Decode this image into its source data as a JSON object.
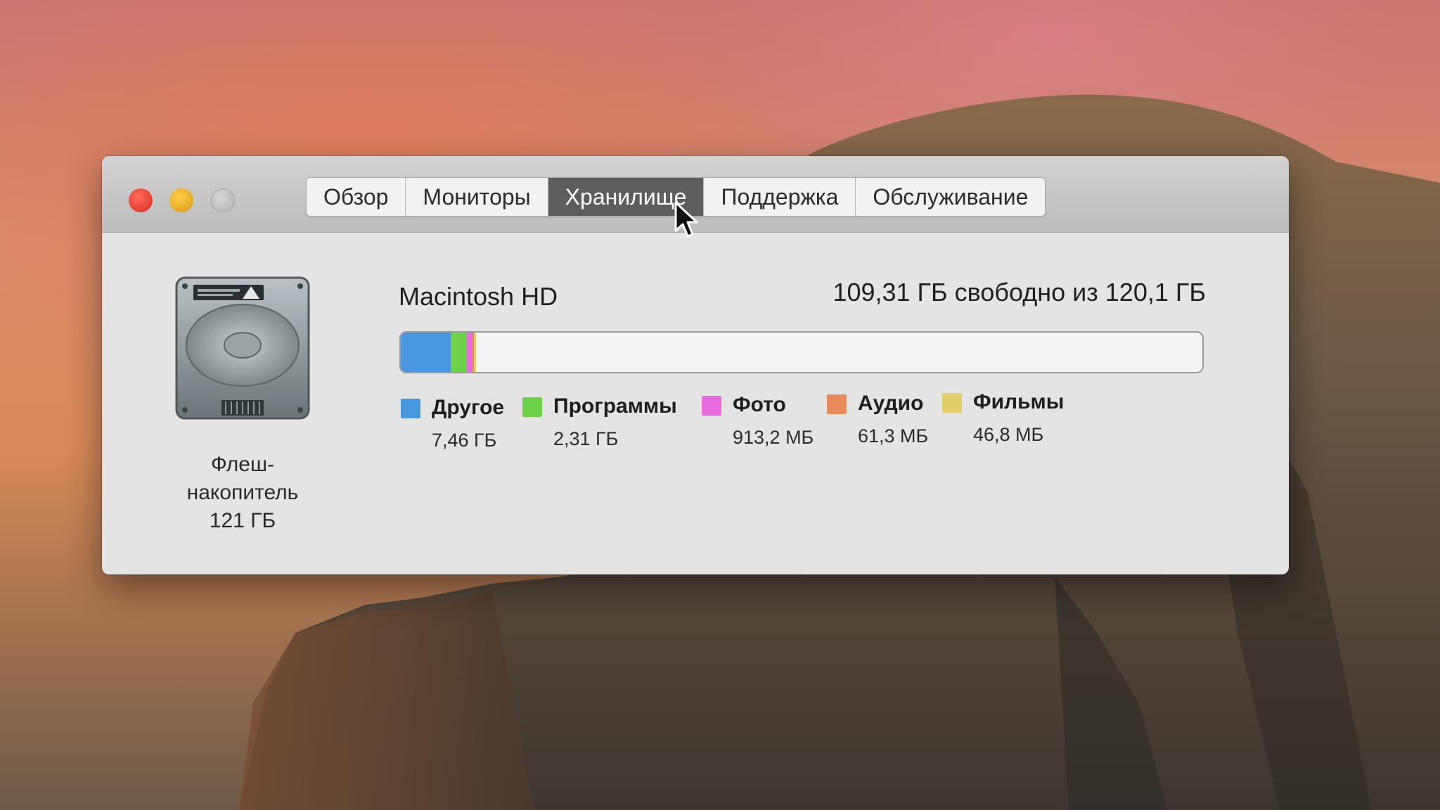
{
  "window": {
    "tabs": [
      {
        "label": "Обзор",
        "active": false
      },
      {
        "label": "Мониторы",
        "active": false
      },
      {
        "label": "Хранилище",
        "active": true
      },
      {
        "label": "Поддержка",
        "active": false
      },
      {
        "label": "Обслуживание",
        "active": false
      }
    ]
  },
  "disk": {
    "icon": "hard-drive-icon",
    "label_lines": [
      "Флеш-",
      "накопитель",
      "121 ГБ"
    ]
  },
  "volume": {
    "name": "Macintosh HD",
    "free_text": "109,31 ГБ свободно из 120,1 ГБ",
    "total_gb": 120.1,
    "free_gb": 109.31
  },
  "usage": [
    {
      "name": "Другое",
      "size": "7,46 ГБ",
      "gb": 7.46,
      "color": "#4a97e0"
    },
    {
      "name": "Программы",
      "size": "2,31 ГБ",
      "gb": 2.31,
      "color": "#6ed14a"
    },
    {
      "name": "Фото",
      "size": "913,2 МБ",
      "gb": 0.9132,
      "color": "#e86be0"
    },
    {
      "name": "Аудио",
      "size": "61,3 МБ",
      "gb": 0.0613,
      "color": "#e88a5a"
    },
    {
      "name": "Фильмы",
      "size": "46,8 МБ",
      "gb": 0.0468,
      "color": "#e2cf6a"
    }
  ],
  "colors": {
    "tab_active_bg": "#5d5d5d",
    "window_bg": "#e4e4e4"
  }
}
